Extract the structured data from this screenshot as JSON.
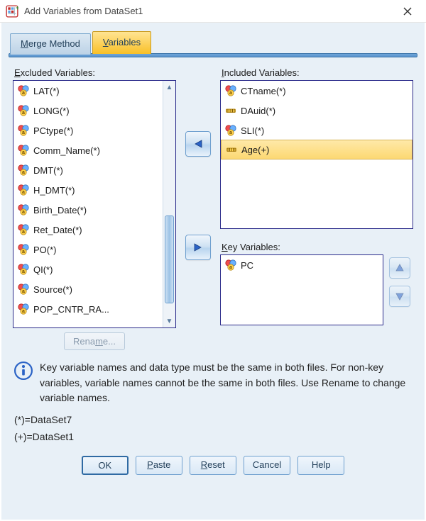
{
  "title": "Add Variables from DataSet1",
  "tabs": {
    "merge": "Merge Method",
    "variables": "Variables"
  },
  "labels": {
    "excluded": "Excluded Variables:",
    "included": "Included Variables:",
    "key": "Key Variables:",
    "rename": "Rename..."
  },
  "excluded": [
    {
      "name": "LAT(*)",
      "kind": "nominal"
    },
    {
      "name": "LONG(*)",
      "kind": "nominal"
    },
    {
      "name": "PCtype(*)",
      "kind": "nominal"
    },
    {
      "name": "Comm_Name(*)",
      "kind": "nominal"
    },
    {
      "name": "DMT(*)",
      "kind": "nominal"
    },
    {
      "name": "H_DMT(*)",
      "kind": "nominal"
    },
    {
      "name": "Birth_Date(*)",
      "kind": "nominal"
    },
    {
      "name": "Ret_Date(*)",
      "kind": "nominal"
    },
    {
      "name": "PO(*)",
      "kind": "nominal"
    },
    {
      "name": "QI(*)",
      "kind": "nominal"
    },
    {
      "name": "Source(*)",
      "kind": "nominal"
    },
    {
      "name": "POP_CNTR_RA...",
      "kind": "nominal"
    }
  ],
  "included": [
    {
      "name": "CTname(*)",
      "kind": "nominal"
    },
    {
      "name": "DAuid(*)",
      "kind": "scale"
    },
    {
      "name": "SLI(*)",
      "kind": "nominal"
    },
    {
      "name": "Age(+)",
      "kind": "scale",
      "selected": true
    }
  ],
  "key": [
    {
      "name": "PC",
      "kind": "nominal"
    }
  ],
  "info": "Key variable names and data type must be the same in both files. For non-key variables, variable names cannot be the same in both files. Use Rename to change variable names.",
  "legend": {
    "star": "(*)=DataSet7",
    "plus": "(+)=DataSet1"
  },
  "buttons": {
    "ok": "OK",
    "paste": "Paste",
    "reset": "Reset",
    "cancel": "Cancel",
    "help": "Help"
  }
}
